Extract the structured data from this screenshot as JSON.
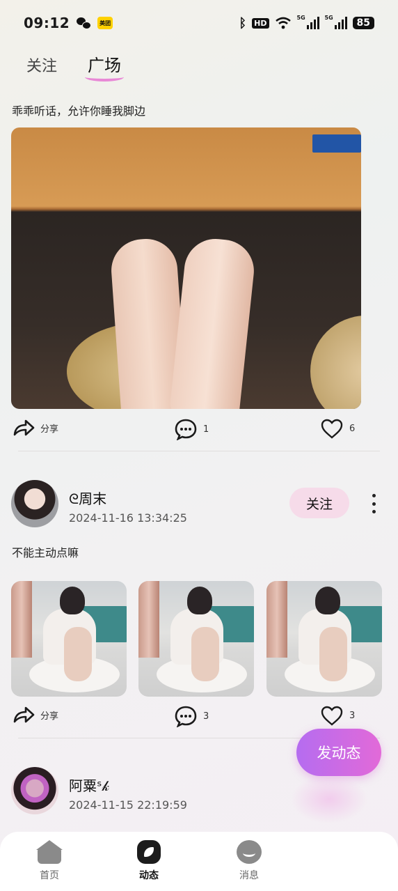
{
  "status_bar": {
    "time": "09:12",
    "meituan": "美团",
    "hd": "HD",
    "signal1": "5G",
    "signal2": "5G",
    "battery": "85"
  },
  "tabs": [
    {
      "label": "关注",
      "active": false
    },
    {
      "label": "广场",
      "active": true
    }
  ],
  "posts": [
    {
      "text": "乖乖听话，允许你睡我脚边",
      "share_label": "分享",
      "comments": "1",
      "likes": "6"
    },
    {
      "username": "ᘓ周末",
      "timestamp": "2024-11-16 13:34:25",
      "follow_label": "关注",
      "text": "不能主动点嘛",
      "share_label": "分享",
      "comments": "3",
      "likes": "3"
    },
    {
      "username": "阿粟ˢ𝓀",
      "timestamp": "2024-11-15 22:19:59"
    }
  ],
  "post_button": "发动态",
  "bottom_nav": [
    {
      "label": "首页",
      "icon": "home-icon",
      "active": false
    },
    {
      "label": "动态",
      "icon": "feed-icon",
      "active": true
    },
    {
      "label": "消息",
      "icon": "message-icon",
      "active": false
    }
  ],
  "colors": {
    "accent_pink": "#e889d6",
    "follow_bg": "#f6dbe9",
    "post_button_start": "#b56cf0",
    "post_button_end": "#e26ad8"
  }
}
